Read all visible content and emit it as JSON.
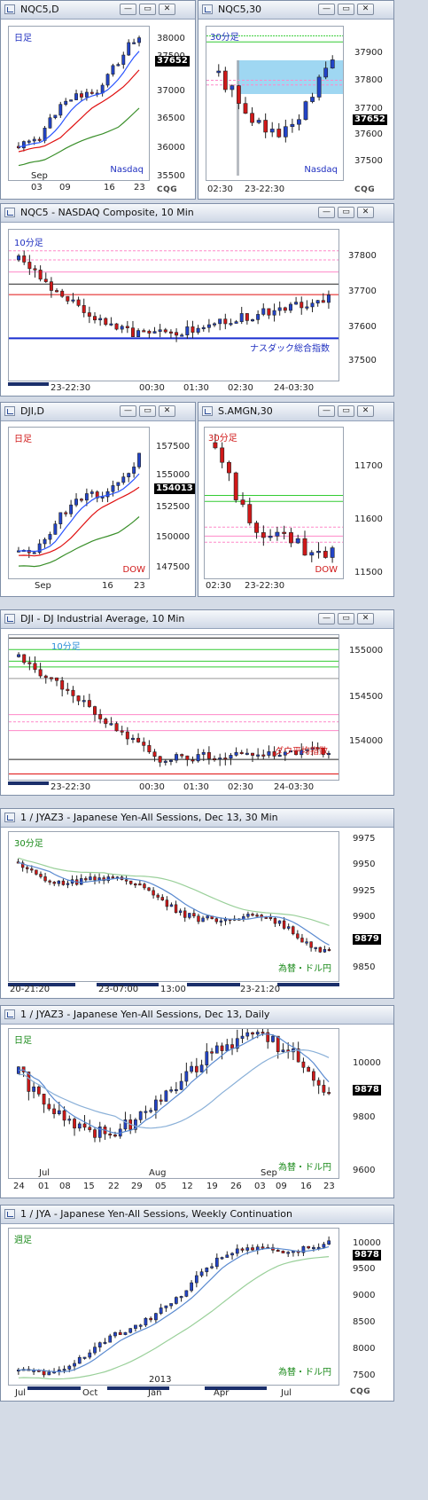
{
  "colors": {
    "up": "#2244c8",
    "down": "#d01818",
    "ma_blue": "#2b55ff",
    "ma_red": "#e01010",
    "ma_green": "#3a8f2a",
    "pink": "#ff88c8",
    "green_line": "#33cc33"
  },
  "buttons": {
    "minimize": "—",
    "restore": "▭",
    "close": "✕"
  },
  "brand": "CQG",
  "windows": [
    {
      "key": "w1",
      "title": "NQC5,D",
      "tf": "日足",
      "tf_color": "#2030c0",
      "src": "Nasdaq",
      "src_color": "#2030c0",
      "last": "37652",
      "y_ticks": [
        "38000",
        "37500",
        "37000",
        "36500",
        "36000",
        "35500"
      ],
      "x_ticks": [
        "03",
        "09",
        "16",
        "23"
      ],
      "x_month": "Sep"
    },
    {
      "key": "w2",
      "title": "NQC5,30",
      "tf": "30分足",
      "tf_color": "#2030c0",
      "src": "Nasdaq",
      "src_color": "#2030c0",
      "last": "37652",
      "y_ticks": [
        "37900",
        "37800",
        "37700",
        "37600",
        "37500"
      ],
      "x_ticks": [
        "02:30",
        "23-22:30"
      ]
    },
    {
      "key": "w3",
      "title": "NQC5 - NASDAQ Composite, 10 Min",
      "tf": "10分足",
      "tf_color": "#2030c0",
      "src": "ナスダック総合指数",
      "src_color": "#2030c0",
      "y_ticks": [
        "37800",
        "37700",
        "37600",
        "37500"
      ],
      "x_ticks": [
        "23-22:30",
        "00:30",
        "01:30",
        "02:30",
        "24-03:30"
      ]
    },
    {
      "key": "w4",
      "title": "DJI,D",
      "tf": "日足",
      "tf_color": "#d01818",
      "src": "DOW",
      "src_color": "#d01818",
      "last": "154013",
      "y_ticks": [
        "157500",
        "155000",
        "152500",
        "150000",
        "147500"
      ],
      "x_ticks": [
        "Sep",
        "16",
        "23"
      ]
    },
    {
      "key": "w5",
      "title": "S.AMGN,30",
      "tf": "30分足",
      "tf_color": "#d01818",
      "src": "DOW",
      "src_color": "#d01818",
      "y_ticks": [
        "11700",
        "11600",
        "11500"
      ],
      "x_ticks": [
        "02:30",
        "23-22:30"
      ]
    },
    {
      "key": "w6",
      "title": "DJI - DJ Industrial Average, 10 Min",
      "tf": "10分足",
      "tf_color": "#2b8ed8",
      "src": "ダウ平均指数",
      "src_color": "#d01818",
      "y_ticks": [
        "155000",
        "154500",
        "154000"
      ],
      "x_ticks": [
        "23-22:30",
        "00:30",
        "01:30",
        "02:30",
        "24-03:30"
      ]
    },
    {
      "key": "w7",
      "title": "1 / JYAZ3 - Japanese Yen-All Sessions, Dec 13, 30 Min",
      "tf": "30分足",
      "tf_color": "#1a8a1a",
      "src": "為替・ドル円",
      "src_color": "#1a8a1a",
      "last": "9879",
      "y_ticks": [
        "9975",
        "9950",
        "9925",
        "9900",
        "9875",
        "9850"
      ],
      "x_ticks": [
        "20-21:20",
        "23-07:00",
        "13:00",
        "23-21:20"
      ]
    },
    {
      "key": "w8",
      "title": "1 / JYAZ3 - Japanese Yen-All Sessions, Dec 13, Daily",
      "tf": "日足",
      "tf_color": "#1a8a1a",
      "src": "為替・ドル円",
      "src_color": "#1a8a1a",
      "last": "9878",
      "y_ticks": [
        "10000",
        "9800",
        "9600"
      ],
      "x_ticks": [
        "24",
        "01",
        "08",
        "15",
        "22",
        "29",
        "05",
        "12",
        "19",
        "26",
        "03",
        "09",
        "16",
        "23"
      ],
      "x_months": [
        "Jul",
        "Aug",
        "Sep"
      ]
    },
    {
      "key": "w9",
      "title": "1 / JYA - Japanese Yen-All Sessions, Weekly Continuation",
      "tf": "週足",
      "tf_color": "#1a8a1a",
      "src": "為替・ドル円",
      "src_color": "#1a8a1a",
      "last": "9878",
      "y_ticks": [
        "10000",
        "9500",
        "9000",
        "8500",
        "8000",
        "7500"
      ],
      "x_ticks": [
        "Jul",
        "Oct",
        "Jan",
        "Apr",
        "Jul"
      ],
      "x_year": "2013"
    }
  ]
}
